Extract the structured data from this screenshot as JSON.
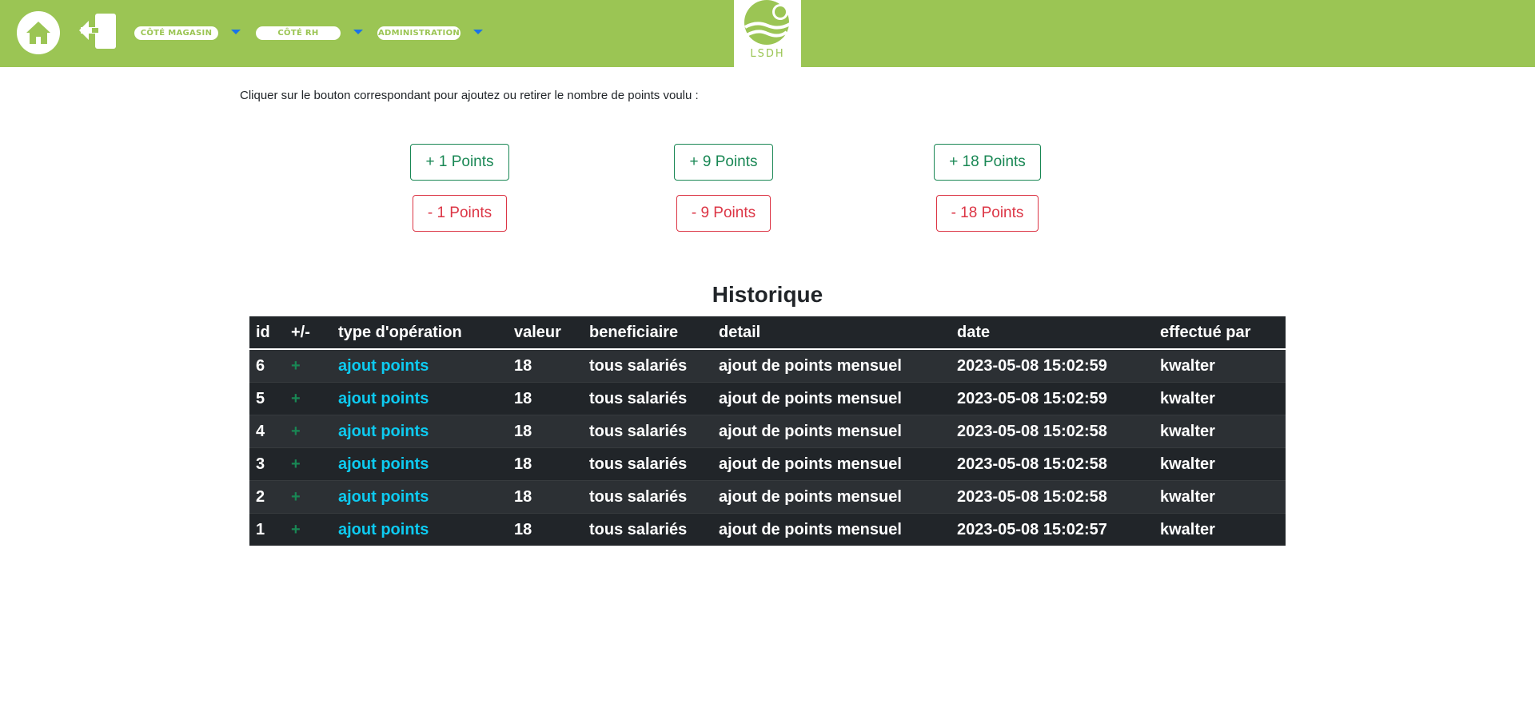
{
  "nav": {
    "menus": [
      {
        "label": "Côté magasin"
      },
      {
        "label": "Côté RH"
      },
      {
        "label": "Administration"
      }
    ],
    "logo_text": "LSDH"
  },
  "instruction": "Cliquer sur le bouton correspondant pour ajoutez ou retirer le nombre de points voulu :",
  "buttons": {
    "add_1": "+ 1 Points",
    "sub_1": "- 1 Points",
    "add_9": "+ 9 Points",
    "sub_9": "- 9 Points",
    "add_18": "+ 18 Points",
    "sub_18": "- 18 Points"
  },
  "history": {
    "title": "Historique",
    "columns": [
      "id",
      "+/-",
      "type d'opération",
      "valeur",
      "beneficiaire",
      "detail",
      "date",
      "effectué par"
    ],
    "rows": [
      {
        "id": "6",
        "sign": "+",
        "type": "ajout points",
        "valeur": "18",
        "beneficiaire": "tous salariés",
        "detail": "ajout de points mensuel",
        "date": "2023-05-08 15:02:59",
        "par": "kwalter"
      },
      {
        "id": "5",
        "sign": "+",
        "type": "ajout points",
        "valeur": "18",
        "beneficiaire": "tous salariés",
        "detail": "ajout de points mensuel",
        "date": "2023-05-08 15:02:59",
        "par": "kwalter"
      },
      {
        "id": "4",
        "sign": "+",
        "type": "ajout points",
        "valeur": "18",
        "beneficiaire": "tous salariés",
        "detail": "ajout de points mensuel",
        "date": "2023-05-08 15:02:58",
        "par": "kwalter"
      },
      {
        "id": "3",
        "sign": "+",
        "type": "ajout points",
        "valeur": "18",
        "beneficiaire": "tous salariés",
        "detail": "ajout de points mensuel",
        "date": "2023-05-08 15:02:58",
        "par": "kwalter"
      },
      {
        "id": "2",
        "sign": "+",
        "type": "ajout points",
        "valeur": "18",
        "beneficiaire": "tous salariés",
        "detail": "ajout de points mensuel",
        "date": "2023-05-08 15:02:58",
        "par": "kwalter"
      },
      {
        "id": "1",
        "sign": "+",
        "type": "ajout points",
        "valeur": "18",
        "beneficiaire": "tous salariés",
        "detail": "ajout de points mensuel",
        "date": "2023-05-08 15:02:57",
        "par": "kwalter"
      }
    ]
  },
  "colors": {
    "header_bg": "#9bc554",
    "add_green": "#198754",
    "sub_red": "#dc3545",
    "type_cyan": "#0dcaf0",
    "table_dark": "#212529"
  }
}
